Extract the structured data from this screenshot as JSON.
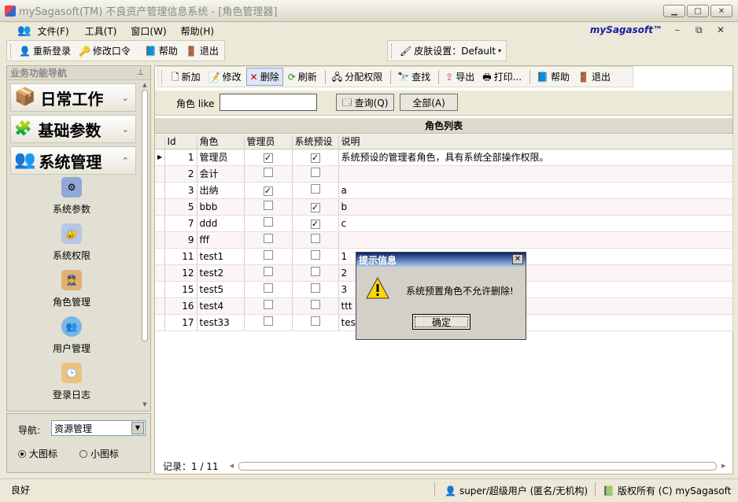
{
  "window": {
    "title": "mySagasoft(TM) 不良资产管理信息系统 - [角色管理器]",
    "brand": "mySagasoft™"
  },
  "menu": {
    "items": [
      {
        "label": "文件(F)"
      },
      {
        "label": "工具(T)"
      },
      {
        "label": "窗口(W)"
      },
      {
        "label": "帮助(H)"
      }
    ]
  },
  "toolbar1": {
    "relogin": "重新登录",
    "change_pwd": "修改口令",
    "help": "帮助",
    "exit": "退出",
    "skin": "皮肤设置：Default"
  },
  "sidebar": {
    "header": "业务功能导航",
    "groups": [
      {
        "label": "日常工作",
        "chevron": "⌄"
      },
      {
        "label": "基础参数",
        "chevron": "⌄"
      },
      {
        "label": "系统管理",
        "chevron": "⌃"
      }
    ],
    "items": [
      {
        "label": "系统参数"
      },
      {
        "label": "系统权限"
      },
      {
        "label": "角色管理"
      },
      {
        "label": "用户管理"
      },
      {
        "label": "登录日志"
      }
    ]
  },
  "nav": {
    "label": "导航:",
    "select_value": "资源管理",
    "radio_large": "大图标",
    "radio_small": "小图标"
  },
  "toolbar2": {
    "new": "新加",
    "edit": "修改",
    "delete": "删除",
    "refresh": "刷新",
    "assign": "分配权限",
    "find": "查找",
    "export": "导出",
    "print": "打印...",
    "help": "帮助",
    "exit": "退出"
  },
  "search": {
    "label": "角色 like",
    "value": "",
    "query_btn": "查询(Q)",
    "all_btn": "全部(A)"
  },
  "grid": {
    "title": "角色列表",
    "columns": [
      "Id",
      "角色",
      "管理员",
      "系统预设",
      "说明"
    ],
    "rows": [
      {
        "id": "1",
        "role": "管理员",
        "admin": true,
        "preset": true,
        "desc": "系统预设的管理者角色，具有系统全部操作权限。"
      },
      {
        "id": "2",
        "role": "会计",
        "admin": false,
        "preset": false,
        "desc": ""
      },
      {
        "id": "3",
        "role": "出纳",
        "admin": true,
        "preset": false,
        "desc": "a"
      },
      {
        "id": "5",
        "role": "bbb",
        "admin": false,
        "preset": true,
        "desc": "b"
      },
      {
        "id": "7",
        "role": "ddd",
        "admin": false,
        "preset": true,
        "desc": "c"
      },
      {
        "id": "9",
        "role": "fff",
        "admin": false,
        "preset": false,
        "desc": ""
      },
      {
        "id": "11",
        "role": "test1",
        "admin": false,
        "preset": false,
        "desc": "1"
      },
      {
        "id": "12",
        "role": "test2",
        "admin": false,
        "preset": false,
        "desc": "2"
      },
      {
        "id": "15",
        "role": "test5",
        "admin": false,
        "preset": false,
        "desc": "3"
      },
      {
        "id": "16",
        "role": "test4",
        "admin": false,
        "preset": false,
        "desc": "ttt"
      },
      {
        "id": "17",
        "role": "test33",
        "admin": false,
        "preset": false,
        "desc": "test"
      }
    ],
    "record_label": "记录：1 / 11"
  },
  "dialog": {
    "title": "提示信息",
    "message": "系统预置角色不允许删除!",
    "ok": "确定"
  },
  "status": {
    "left": "良好",
    "user": "super/超级用户 (匿名/无机构)",
    "copyright": "版权所有 (C) mySagasoft"
  },
  "colors": {
    "title_gradient_start": "#0a246a",
    "title_gradient_end": "#a6caf0",
    "brand": "#1a1aa0"
  }
}
